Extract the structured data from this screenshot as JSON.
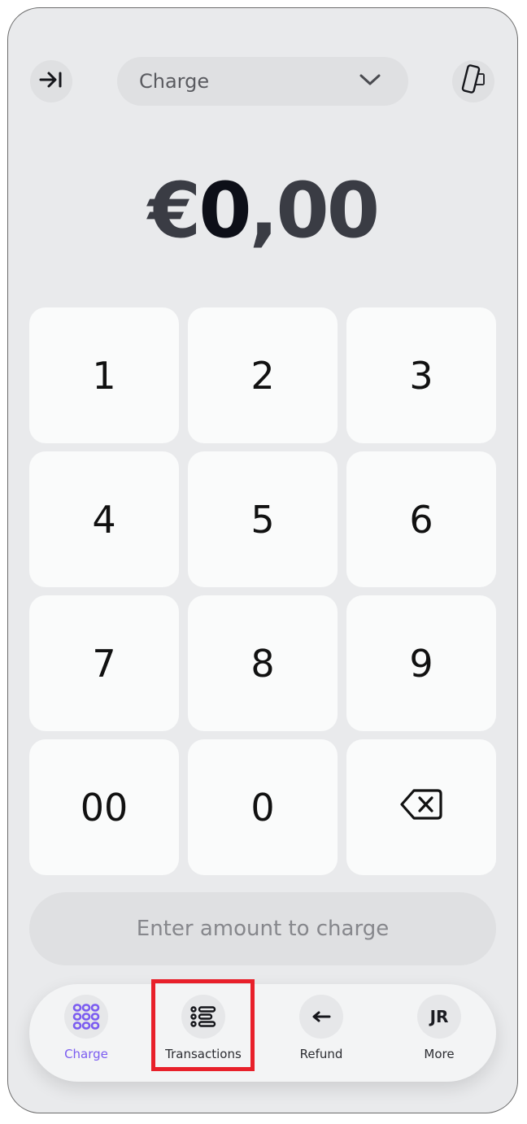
{
  "header": {
    "exit_icon": "arrow-right-to-bar-icon",
    "mode_select": {
      "selected": "Charge",
      "icon": "chevron-down-icon"
    },
    "device_icon": "card-reader-phone-icon"
  },
  "amount": {
    "currency": "€",
    "integer": "0",
    "separator": ",",
    "decimals": "00"
  },
  "keypad": {
    "keys": [
      "1",
      "2",
      "3",
      "4",
      "5",
      "6",
      "7",
      "8",
      "9",
      "00",
      "0"
    ],
    "backspace_icon": "backspace-icon"
  },
  "cta": {
    "label": "Enter amount to charge"
  },
  "bottom_nav": {
    "items": [
      {
        "label": "Charge",
        "icon": "keypad-grid-icon",
        "active": true
      },
      {
        "label": "Transactions",
        "icon": "list-icon",
        "active": false
      },
      {
        "label": "Refund",
        "icon": "arrow-left-icon",
        "active": false
      },
      {
        "label": "More",
        "avatar_initials": "JR",
        "active": false
      }
    ]
  },
  "colors": {
    "accent": "#7b5cf0",
    "background": "#e9eaec",
    "key": "#fafbfb",
    "highlight": "#e8202a"
  }
}
